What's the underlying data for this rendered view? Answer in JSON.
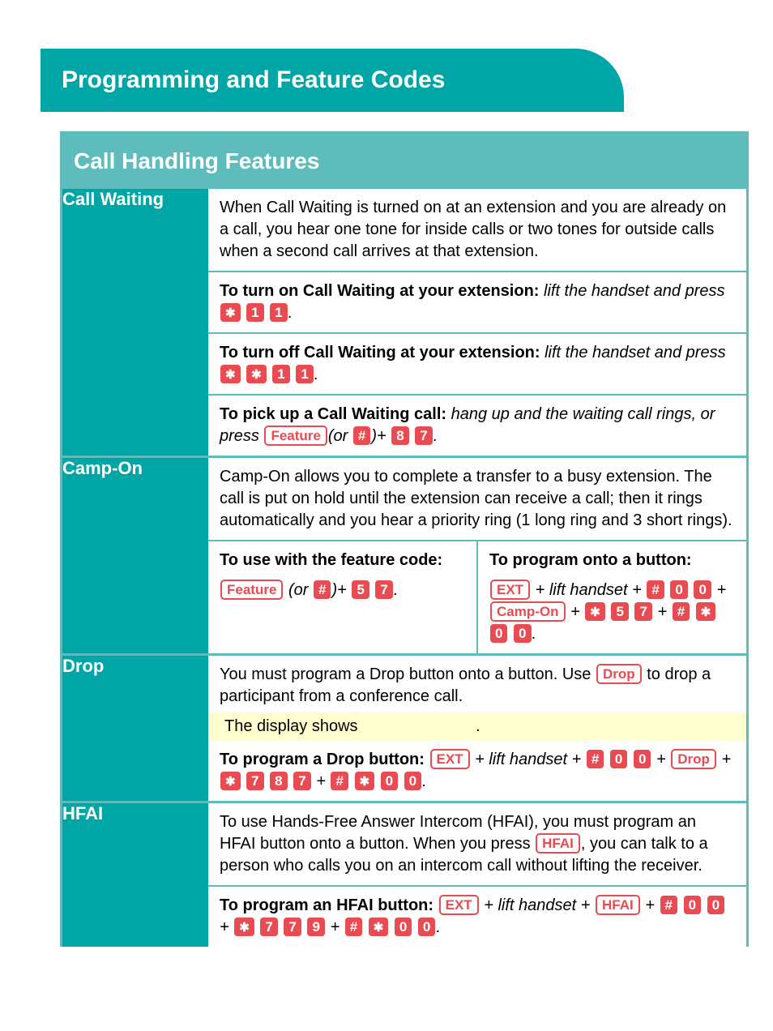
{
  "header": {
    "title": "Programming and Feature Codes"
  },
  "section": {
    "title": "Call Handling Features"
  },
  "rows": {
    "callWaiting": {
      "label": "Call Waiting",
      "desc": "When Call Waiting is turned on at an extension and you are already on a call, you hear one tone for inside calls or two tones for outside calls when a second call arrives at that extension.",
      "onLead": "To turn on Call Waiting at your extension: ",
      "onAction": "lift the handset and press ",
      "offLead": "To turn off Call Waiting at your extension: ",
      "offAction": "lift the handset and press ",
      "pickLead": "To pick up a Call Waiting call: ",
      "pickAction": "hang up and the waiting call rings, or press ",
      "or": "(or ",
      "plus": ")+ ",
      "btnFeature": "Feature",
      "period": "."
    },
    "campOn": {
      "label": "Camp-On",
      "desc": "Camp-On allows you to complete a transfer to a busy extension. The call is put on hold until the extension can receive a call; then it rings automatically and you hear a priority ring (1 long ring and 3 short rings).",
      "leftHead": "To use with the feature code:",
      "rightHead": "To program onto a button:",
      "or": " (or ",
      "plus": ")+ ",
      "btnFeature": "Feature",
      "btnExt": "EXT",
      "btnCampOn": "Camp-On",
      "liftText": " + lift handset + ",
      "plusSym": " + ",
      "period": "."
    },
    "drop": {
      "label": "Drop",
      "descA": "You must program a Drop button onto a button. Use ",
      "descB": " to drop a participant from a conference call.",
      "highlight": "The display shows",
      "highlightEnd": ".",
      "progLead": "To program a Drop button:  ",
      "btnExt": "EXT",
      "btnDrop": "Drop",
      "liftText": " + lift handset + ",
      "plusSym": " + ",
      "period": "."
    },
    "hfai": {
      "label": "HFAI",
      "descA": "To use Hands-Free Answer Intercom (HFAI), you must program an HFAI button onto a button. When you press ",
      "descB": ", you can talk to a person who calls you on an intercom call without lifting the receiver.",
      "progLead": "To program an HFAI button:  ",
      "btnExt": "EXT",
      "btnHfai": "HFAI",
      "liftText": " + lift handset + ",
      "plusSym": " + ",
      "period": "."
    }
  },
  "digits": {
    "d0": "0",
    "d1": "1",
    "d5": "5",
    "d7": "7",
    "d8": "8",
    "d9": "9",
    "hash": "#"
  }
}
